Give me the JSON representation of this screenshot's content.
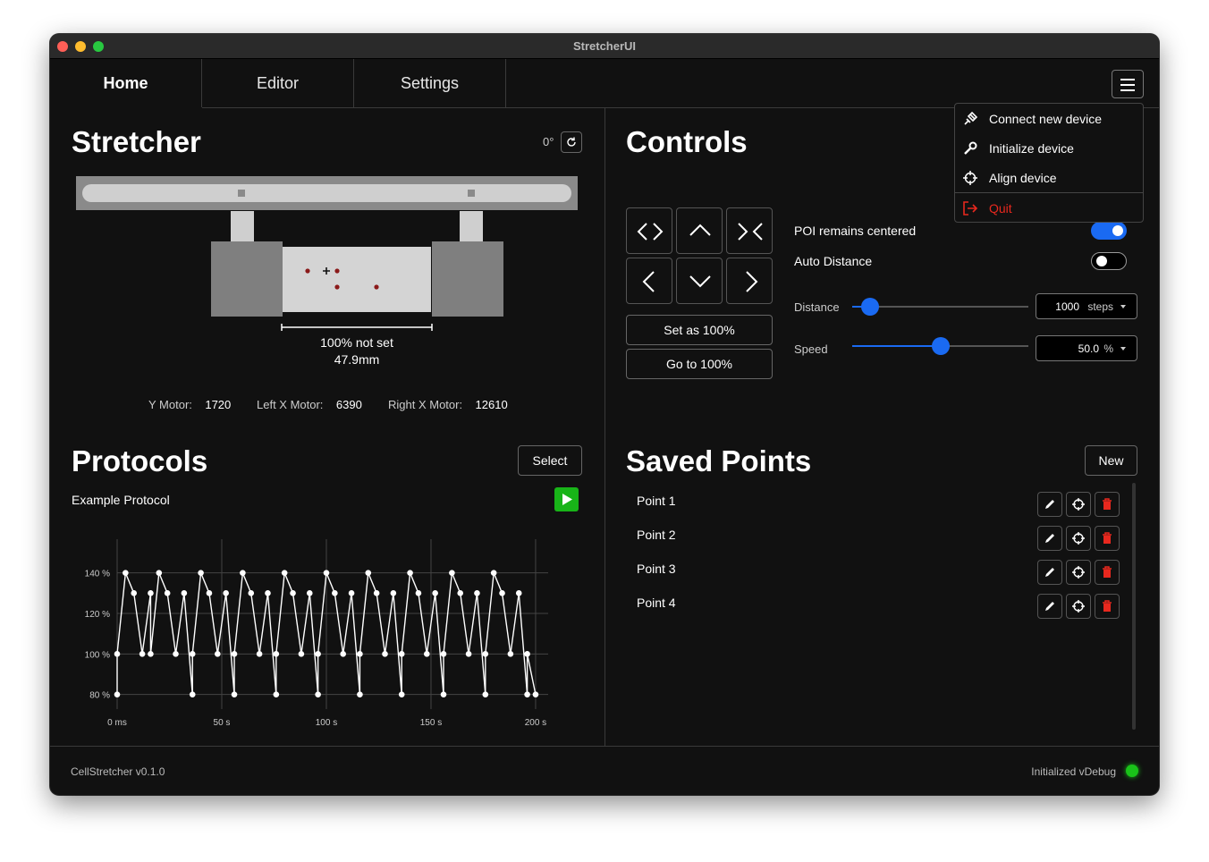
{
  "window": {
    "title": "StretcherUI"
  },
  "tabs": [
    "Home",
    "Editor",
    "Settings"
  ],
  "menu": {
    "items": [
      {
        "label": "Connect new device",
        "icon": "plug-icon"
      },
      {
        "label": "Initialize device",
        "icon": "wrench-icon"
      },
      {
        "label": "Align device",
        "icon": "crosshair-icon"
      },
      {
        "label": "Quit",
        "icon": "exit-icon",
        "color": "#e8281e"
      }
    ]
  },
  "stretcher": {
    "title": "Stretcher",
    "rotation": "0°",
    "scale_text": "100% not set",
    "length": "47.9mm",
    "motors": [
      {
        "label": "Y Motor:",
        "value": "1720"
      },
      {
        "label": "Left X Motor:",
        "value": "6390"
      },
      {
        "label": "Right X Motor:",
        "value": "12610"
      }
    ]
  },
  "controls": {
    "title": "Controls",
    "set_label": "Set as 100%",
    "goto_label": "Go to 100%",
    "poi_label": "POI remains centered",
    "poi_on": true,
    "auto_label": "Auto Distance",
    "auto_on": false,
    "distance_label": "Distance",
    "distance_value": "1000",
    "distance_unit": "steps",
    "distance_fraction": 0.1,
    "speed_label": "Speed",
    "speed_value": "50.0",
    "speed_unit": "%",
    "speed_fraction": 0.5
  },
  "protocols": {
    "title": "Protocols",
    "select_label": "Select",
    "name": "Example Protocol"
  },
  "chart_data": {
    "type": "line",
    "title": "",
    "xlabel": "",
    "ylabel": "",
    "x_ticks": [
      {
        "v": 0,
        "label": "0 ms"
      },
      {
        "v": 50,
        "label": "50 s"
      },
      {
        "v": 100,
        "label": "100 s"
      },
      {
        "v": 150,
        "label": "150 s"
      },
      {
        "v": 200,
        "label": "200 s"
      }
    ],
    "y_ticks": [
      {
        "v": 80,
        "label": "80 %"
      },
      {
        "v": 100,
        "label": "100 %"
      },
      {
        "v": 120,
        "label": "120 %"
      },
      {
        "v": 140,
        "label": "140 %"
      }
    ],
    "xlim": [
      0,
      206
    ],
    "ylim": [
      75,
      150
    ],
    "grid": true,
    "series": [
      {
        "x": [
          0,
          0,
          4,
          8,
          12,
          16,
          16,
          20,
          24,
          28,
          32,
          36,
          36,
          40,
          44,
          48,
          52,
          56,
          56,
          60,
          64,
          68,
          72,
          76,
          76,
          80,
          84,
          88,
          92,
          96,
          96,
          100,
          104,
          108,
          112,
          116,
          116,
          120,
          124,
          128,
          132,
          136,
          136,
          140,
          144,
          148,
          152,
          156,
          156,
          160,
          164,
          168,
          172,
          176,
          176,
          180,
          184,
          188,
          192,
          196,
          196,
          200
        ],
        "y": [
          80,
          100,
          140,
          130,
          100,
          130,
          100,
          140,
          130,
          100,
          130,
          80,
          100,
          140,
          130,
          100,
          130,
          80,
          100,
          140,
          130,
          100,
          130,
          80,
          100,
          140,
          130,
          100,
          130,
          80,
          100,
          140,
          130,
          100,
          130,
          80,
          100,
          140,
          130,
          100,
          130,
          80,
          100,
          140,
          130,
          100,
          130,
          80,
          100,
          140,
          130,
          100,
          130,
          80,
          100,
          140,
          130,
          100,
          130,
          80,
          100,
          80
        ]
      }
    ]
  },
  "saved_points": {
    "title": "Saved Points",
    "new_label": "New",
    "items": [
      {
        "name": "Point 1"
      },
      {
        "name": "Point 2"
      },
      {
        "name": "Point 3"
      },
      {
        "name": "Point 4"
      }
    ]
  },
  "footer": {
    "version": "CellStretcher v0.1.0",
    "status": "Initialized vDebug",
    "status_color": "#19c219"
  },
  "colors": {
    "accent": "#1a6af2",
    "play": "#18b418",
    "delete": "#e8281e"
  }
}
